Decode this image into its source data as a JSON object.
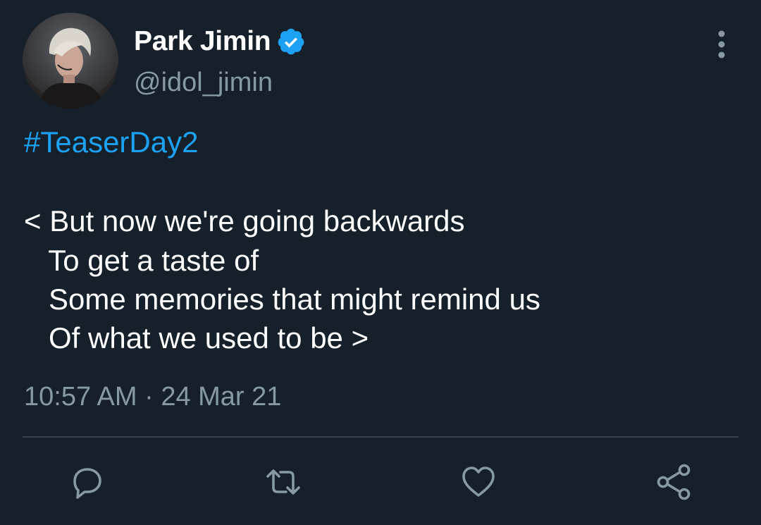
{
  "author": {
    "display_name": "Park Jimin",
    "handle": "@idol_jimin",
    "verified": true
  },
  "tweet": {
    "hashtag": "#TeaserDay2",
    "lines": [
      "< But now we're going backwards",
      "   To get a taste of",
      "   Some memories that might remind us",
      "   Of what we used to be >"
    ],
    "timestamp": "10:57 AM · 24 Mar 21"
  },
  "actions": {
    "icons": [
      "reply-icon",
      "retweet-icon",
      "like-icon",
      "share-icon"
    ]
  },
  "colors": {
    "background": "#15202b",
    "accent": "#1da1f2",
    "secondary_text": "#8899a6",
    "divider": "#38444d"
  }
}
